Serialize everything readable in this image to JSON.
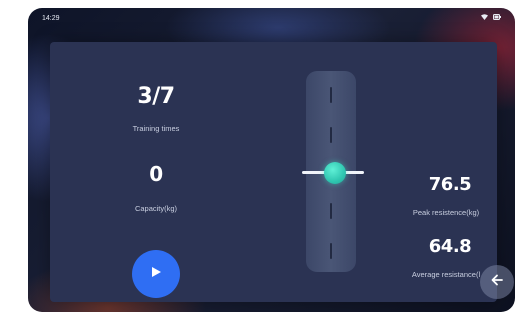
{
  "status_bar": {
    "time": "14:29",
    "wifi_icon": "wifi-icon",
    "battery_icon": "battery-icon"
  },
  "stats": {
    "training_times": {
      "value": "3/7",
      "label": "Training times"
    },
    "capacity": {
      "value": "0",
      "label": "Capacity(kg)"
    },
    "peak_resistance": {
      "value": "76.5",
      "label": "Peak resistence(kg)"
    },
    "average_resistance": {
      "value": "64.8",
      "label": "Average resistance(l"
    }
  },
  "slider": {
    "level": 0.5
  },
  "controls": {
    "play_icon": "play-icon",
    "back_icon": "arrow-left-icon"
  },
  "colors": {
    "panel": "#2b3353",
    "accent_blue": "#2f6ef3",
    "thumb_teal": "#2fc6b0"
  }
}
